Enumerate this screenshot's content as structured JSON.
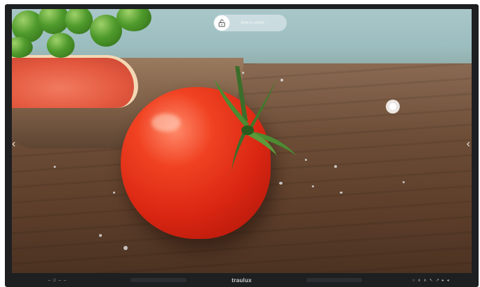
{
  "screen": {
    "lock_slider": {
      "label": "Slide to unlock",
      "icon": "unlock-icon"
    },
    "floating_button_icon": "floating-menu-dot",
    "left_arrow": "‹",
    "right_arrow": "‹",
    "wallpaper_subject": "tomato"
  },
  "bezel": {
    "brand": "traulux",
    "left_controls": [
      "–",
      "□",
      "–",
      "–"
    ],
    "right_controls": [
      "○",
      "∧",
      "∧",
      "↖",
      "↗",
      "▸",
      "◂"
    ]
  },
  "colors": {
    "bezel": "#1e1f21",
    "brand_text": "#cfd1d3",
    "tomato": "#d92612"
  }
}
